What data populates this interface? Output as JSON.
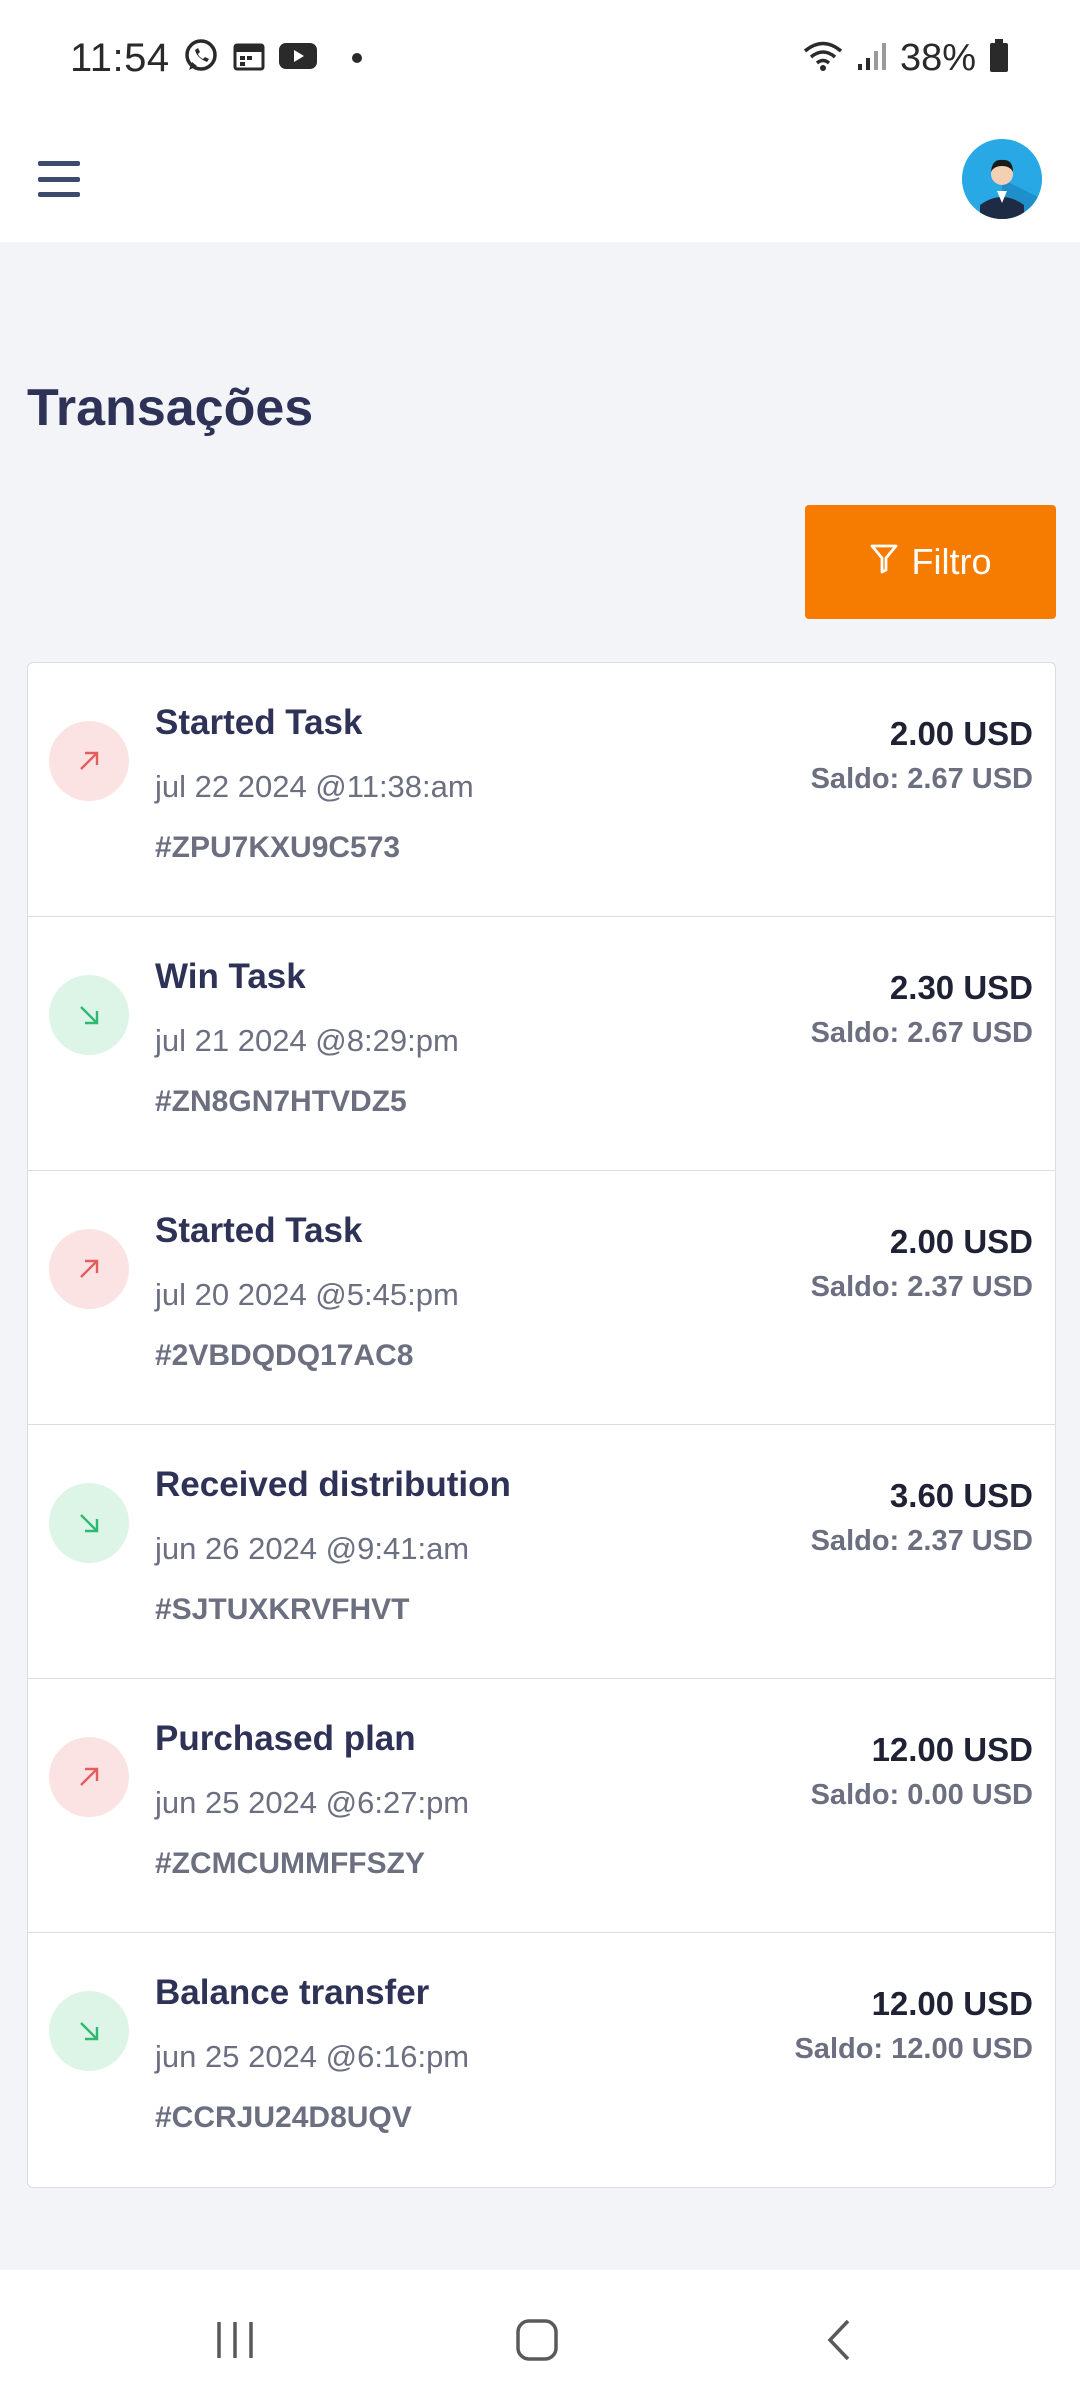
{
  "status_bar": {
    "time": "11:54",
    "battery": "38%"
  },
  "page": {
    "title": "Transações",
    "filter_label": "Filtro"
  },
  "colors": {
    "accent": "#f57c00",
    "outgoing": "#e35d5d",
    "incoming": "#2eb872",
    "title": "#2e3257"
  },
  "transactions": [
    {
      "title": "Started Task",
      "date": "jul 22 2024 @11:38:am",
      "ref": "#ZPU7KXU9C573",
      "amount": "2.00 USD",
      "balance": "Saldo: 2.67 USD",
      "direction": "out"
    },
    {
      "title": "Win Task",
      "date": "jul 21 2024 @8:29:pm",
      "ref": "#ZN8GN7HTVDZ5",
      "amount": "2.30 USD",
      "balance": "Saldo: 2.67 USD",
      "direction": "in"
    },
    {
      "title": "Started Task",
      "date": "jul 20 2024 @5:45:pm",
      "ref": "#2VBDQDQ17AC8",
      "amount": "2.00 USD",
      "balance": "Saldo: 2.37 USD",
      "direction": "out"
    },
    {
      "title": "Received distribution",
      "date": "jun 26 2024 @9:41:am",
      "ref": "#SJTUXKRVFHVT",
      "amount": "3.60 USD",
      "balance": "Saldo: 2.37 USD",
      "direction": "in"
    },
    {
      "title": "Purchased plan",
      "date": "jun 25 2024 @6:27:pm",
      "ref": "#ZCMCUMMFFSZY",
      "amount": "12.00 USD",
      "balance": "Saldo: 0.00 USD",
      "direction": "out"
    },
    {
      "title": "Balance transfer",
      "date": "jun 25 2024 @6:16:pm",
      "ref": "#CCRJU24D8UQV",
      "amount": "12.00 USD",
      "balance": "Saldo: 12.00 USD",
      "direction": "in"
    }
  ],
  "icons": {
    "menu": "hamburger-menu-icon",
    "avatar": "user-avatar",
    "filter": "filter-icon",
    "outgoing": "arrow-up-right-icon",
    "incoming": "arrow-down-right-icon"
  }
}
